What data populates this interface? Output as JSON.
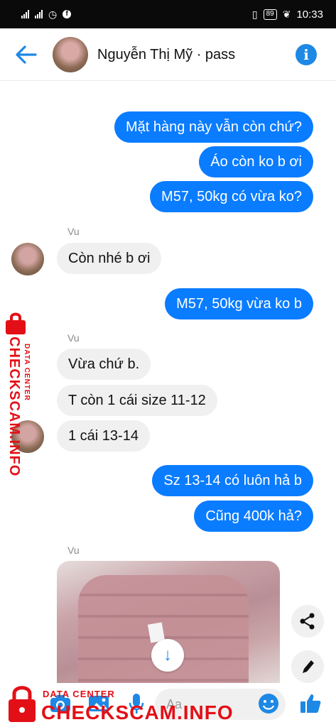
{
  "status_bar": {
    "time": "10:33",
    "battery": "89"
  },
  "header": {
    "contact_name": "Nguyễn Thị Mỹ · pass"
  },
  "messages": [
    {
      "side": "out",
      "text": "Mặt hàng này vẫn còn chứ?"
    },
    {
      "side": "out",
      "text": "Áo còn ko b ơi"
    },
    {
      "side": "out",
      "text": "M57, 50kg có vừa ko?"
    },
    {
      "side": "in",
      "sender": "Vu",
      "text": "Còn nhé b ơi"
    },
    {
      "side": "out",
      "text": "M57, 50kg vừa ko b"
    },
    {
      "side": "in",
      "sender": "Vu",
      "text": "Vừa chứ b."
    },
    {
      "side": "in",
      "text": "T còn 1 cái size 11-12"
    },
    {
      "side": "in",
      "text": "1 cái 13-14"
    },
    {
      "side": "out",
      "text": "Sz 13-14 có luôn hả b"
    },
    {
      "side": "out",
      "text": "Cũng 400k hả?"
    }
  ],
  "senders": {
    "vu_1": "Vu",
    "vu_2": "Vu",
    "vu_3": "Vu"
  },
  "composer": {
    "placeholder": "Aa"
  },
  "watermark": {
    "subtitle": "DATA CENTER",
    "title": "CHECKSCAM.INFO"
  },
  "colors": {
    "outgoing_bubble": "#0a7cff",
    "incoming_bubble": "#f0f0f0",
    "accent": "#1e88e5",
    "watermark": "#e30f16"
  },
  "icons": [
    "back-arrow-icon",
    "info-icon",
    "share-icon",
    "edit-icon",
    "download-icon",
    "camera-icon",
    "gallery-icon",
    "microphone-icon",
    "emoji-icon",
    "like-icon",
    "lock-icon"
  ]
}
